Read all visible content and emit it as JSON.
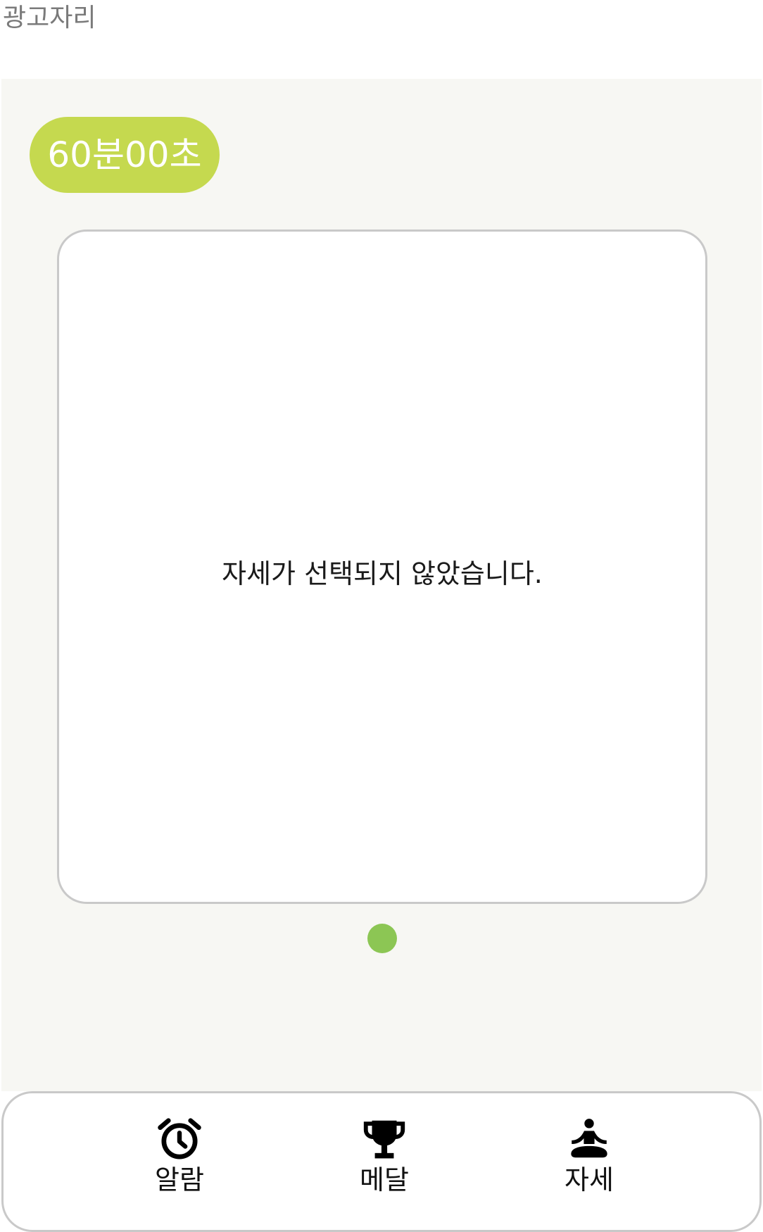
{
  "ad": {
    "label": "광고자리"
  },
  "timer": {
    "text": "60분00초",
    "color": "#c5d94f"
  },
  "card": {
    "message": "자세가 선택되지 않았습니다."
  },
  "pager": {
    "active_color": "#8cc654",
    "count": 1,
    "active_index": 0
  },
  "nav": {
    "items": [
      {
        "label": "알람",
        "icon": "alarm-clock-icon"
      },
      {
        "label": "메달",
        "icon": "trophy-icon"
      },
      {
        "label": "자세",
        "icon": "meditation-pose-icon"
      }
    ]
  }
}
